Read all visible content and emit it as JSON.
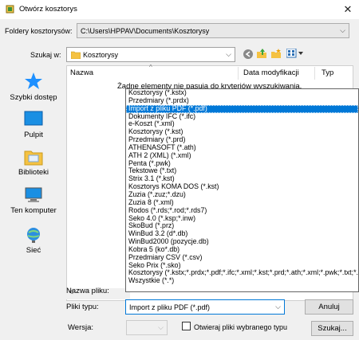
{
  "window": {
    "title": "Otwórz kosztorys",
    "close_glyph": "✕"
  },
  "folders": {
    "label": "Foldery kosztorysów:",
    "value": "C:\\Users\\HPPAV\\Documents\\Kosztorysy"
  },
  "search_in": {
    "label": "Szukaj w:",
    "value": "Kosztorysy"
  },
  "toolbar": {
    "icons": [
      "back-icon",
      "up-folder-icon",
      "new-folder-icon",
      "view-menu-icon"
    ]
  },
  "places": [
    {
      "label": "Szybki dostęp",
      "icon": "star-icon"
    },
    {
      "label": "Pulpit",
      "icon": "desktop-icon"
    },
    {
      "label": "Biblioteki",
      "icon": "libraries-icon"
    },
    {
      "label": "Ten komputer",
      "icon": "computer-icon"
    },
    {
      "label": "Sieć",
      "icon": "network-icon"
    }
  ],
  "file_list": {
    "columns": [
      "Nazwa",
      "Data modyfikacji",
      "Typ"
    ],
    "empty_message": "Żadne elementy nie pasują do kryteriów wyszukiwania."
  },
  "filetype_options": [
    "Kosztorysy (*.kstx)",
    "Przedmiary (*.prdx)",
    "Import z pliku PDF (*.pdf)",
    "Dokumenty IFC (*.ifc)",
    "e-Koszt (*.xml)",
    "Kosztorysy (*.kst)",
    "Przedmiary (*.prd)",
    "ATHENASOFT (*.ath)",
    "ATH 2 (XML) (*.xml)",
    "Penta (*.pwk)",
    "Tekstowe (*.txt)",
    "Strix 3.1 (*.kst)",
    "Kosztorys KOMA DOS (*.kst)",
    "Zuzia (*.zuz;*.dzu)",
    "Zuzia 8 (*.xml)",
    "Rodos (*.rds;*.rod;*.rds7)",
    "Seko 4.0 (*.ksp;*.inw)",
    "SkoBud (*.prz)",
    "WinBud 3.2 (d*.db)",
    "WinBud2000 (pozycje.db)",
    "Kobra 5 (ko*.db)",
    "Przedmiary CSV (*.csv)",
    "Seko Prix (*.sko)",
    "Kosztorysy (*.kstx;*.prdx;*.pdf;*.ifc;*.xml;*.kst;*.prd;*.ath;*.xml;*.pwk;*.txt;*.kst;*",
    "Wszystkie (*.*)"
  ],
  "selected_option_index": 2,
  "bottom": {
    "filename_label": "Nazwa pliku:",
    "filetype_label": "Pliki typu:",
    "filetype_value": "Import z pliku PDF (*.pdf)",
    "cancel": "Anuluj",
    "version_label": "Wersja:",
    "readonly_label": "Otwieraj pliki wybranego typu",
    "search_button": "Szukaj..."
  },
  "colors": {
    "accent": "#0078d7",
    "star": "#1e90ff",
    "folder": "#f5c242"
  }
}
